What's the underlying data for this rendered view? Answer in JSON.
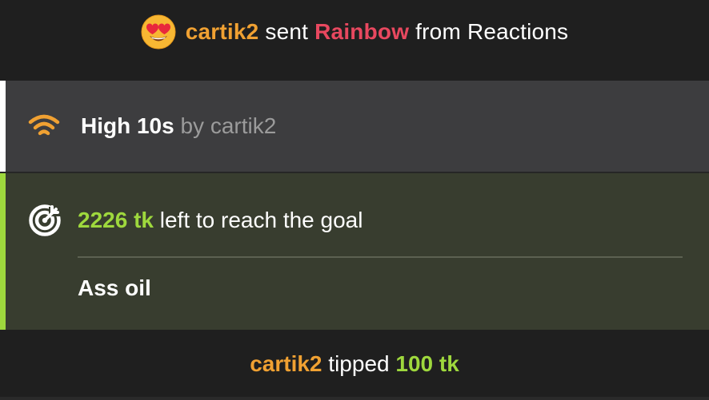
{
  "reaction": {
    "emoji": "heart-eyes-emoji",
    "user": "cartik2",
    "sent_text": " sent ",
    "gift": "Rainbow",
    "from_text": " from Reactions"
  },
  "high": {
    "icon": "wifi-signal-icon",
    "title": "High 10s",
    "by_text": " by cartik2"
  },
  "goal": {
    "icon": "target-icon",
    "amount": "2226 tk",
    "rest_text": " left to reach the goal",
    "name": "Ass oil"
  },
  "tip": {
    "user": "cartik2",
    "tipped_text": " tipped ",
    "amount": "100 tk"
  },
  "colors": {
    "user": "#f0a132",
    "gift": "#e8485f",
    "accent_green": "#9ed83d",
    "goal_bg": "#383d2f",
    "panel_bg": "#3d3d3f",
    "page_bg": "#1f1f1f"
  }
}
